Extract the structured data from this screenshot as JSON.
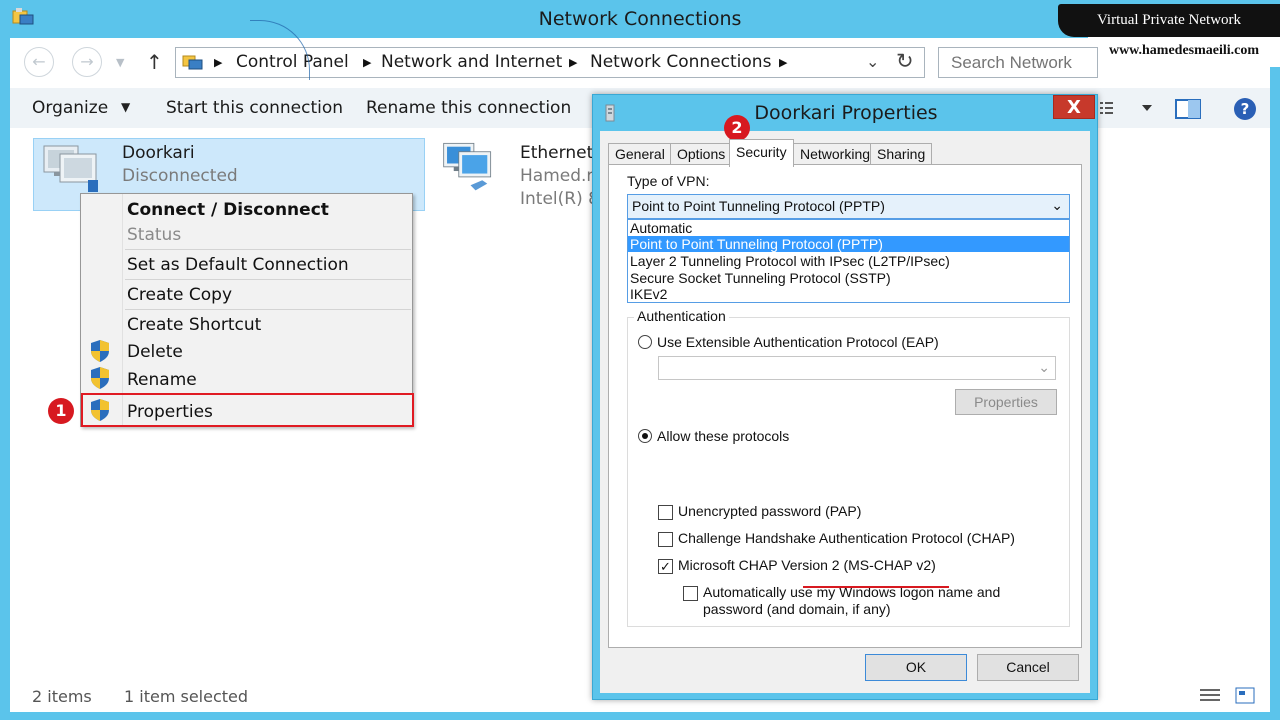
{
  "window": {
    "title": "Network Connections"
  },
  "watermark": {
    "banner": "Virtual Private Network",
    "site": "www.hamedesmaeili.com"
  },
  "nav": {
    "breadcrumbs": [
      "Control Panel",
      "Network and Internet",
      "Network Connections"
    ],
    "search_placeholder": "Search Network"
  },
  "toolbar": {
    "organize": "Organize",
    "start_connection": "Start this connection",
    "rename_connection": "Rename this connection"
  },
  "items": [
    {
      "name": "Doorkari",
      "status": "Disconnected"
    },
    {
      "name": "Ethernet",
      "sub1": "Hamed.r",
      "sub2": "Intel(R) 8"
    }
  ],
  "context_menu": {
    "connect": "Connect / Disconnect",
    "status": "Status",
    "set_default": "Set as Default Connection",
    "create_copy": "Create Copy",
    "create_shortcut": "Create Shortcut",
    "delete": "Delete",
    "rename": "Rename",
    "properties": "Properties"
  },
  "badges": {
    "one": "1",
    "two": "2"
  },
  "statusbar": {
    "items": "2 items",
    "selected": "1 item selected"
  },
  "dialog": {
    "title": "Doorkari Properties",
    "close": "X",
    "tabs": [
      "General",
      "Options",
      "Security",
      "Networking",
      "Sharing"
    ],
    "type_of_vpn_label": "Type of VPN:",
    "vpn_selected": "Point to Point Tunneling Protocol (PPTP)",
    "vpn_options": [
      "Automatic",
      "Point to Point Tunneling Protocol (PPTP)",
      "Layer 2 Tunneling Protocol with IPsec (L2TP/IPsec)",
      "Secure Socket Tunneling Protocol (SSTP)",
      "IKEv2"
    ],
    "auth_legend": "Authentication",
    "eap_radio": "Use Extensible Authentication Protocol (EAP)",
    "eap_properties": "Properties",
    "allow_radio": "Allow these protocols",
    "pap": "Unencrypted password (PAP)",
    "chap": "Challenge Handshake Authentication Protocol (CHAP)",
    "mschap": "Microsoft CHAP Version 2 (MS-CHAP v2)",
    "auto_logon_line1": "Automatically use my Windows logon name and",
    "auto_logon_line2": "password (and domain, if any)",
    "ok": "OK",
    "cancel": "Cancel"
  },
  "colors": {
    "accent": "#5bc4eb",
    "highlight": "#d71920",
    "selection": "#3399ff"
  }
}
